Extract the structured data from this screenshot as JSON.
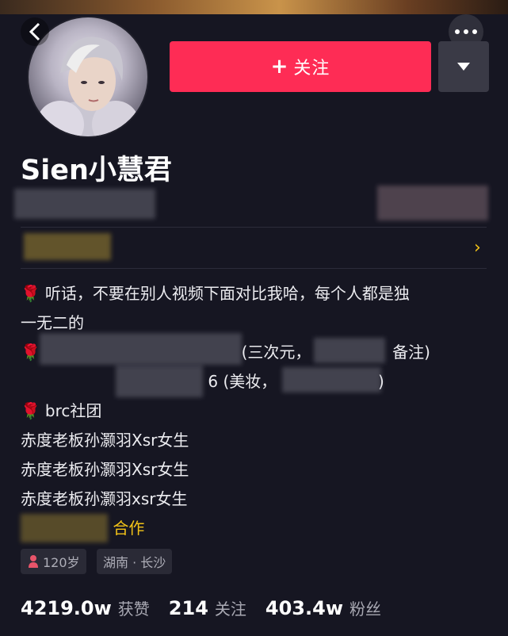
{
  "header": {
    "follow_label": "关注",
    "follow_plus": "+"
  },
  "profile": {
    "name": "Sien小慧君"
  },
  "bio": {
    "line1": "听话，不要在别人视频下面对比我哈，每个人都是独",
    "line2": "一无二的",
    "line3_visible": "(三次元，",
    "line3_end": "备注)",
    "line4_visible": "6 (美妆，",
    "line4_end": ")",
    "line5": "brc社团",
    "line6": "赤度老板孙灏羽Xsr女生",
    "line7": "赤度老板孙灏羽Xsr女生",
    "line8": "赤度老板孙灏羽xsr女生",
    "line9_end": "合作"
  },
  "tags": {
    "age": "120岁",
    "location": "湖南 · 长沙"
  },
  "stats": {
    "likes_value": "4219.0w",
    "likes_label": "获赞",
    "following_value": "214",
    "following_label": "关注",
    "followers_value": "403.4w",
    "followers_label": "粉丝"
  },
  "icons": {
    "back": "back-arrow-icon",
    "more": "more-dots-icon",
    "dropdown": "caret-down-icon",
    "rose": "rose-emoji-icon",
    "chevron": "chevron-right-icon",
    "female": "female-icon"
  },
  "colors": {
    "accent": "#fe2c55",
    "background": "#161622",
    "chevron": "#f3c318"
  }
}
